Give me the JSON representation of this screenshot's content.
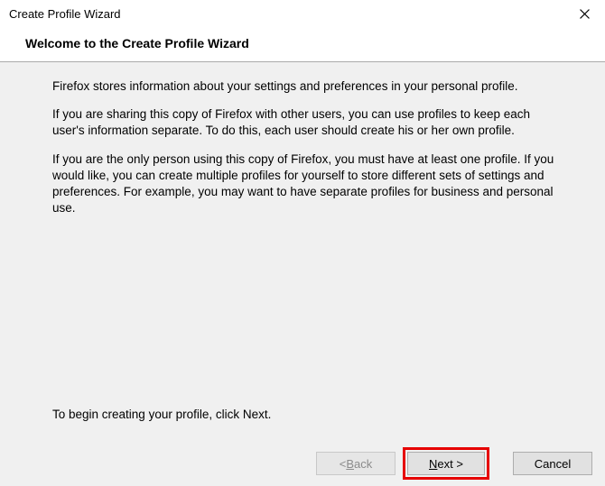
{
  "titlebar": {
    "title": "Create Profile Wizard"
  },
  "header": {
    "title": "Welcome to the Create Profile Wizard"
  },
  "body": {
    "p1": "Firefox stores information about your settings and preferences in your personal profile.",
    "p2": "If you are sharing this copy of Firefox with other users, you can use profiles to keep each user's information separate. To do this, each user should create his or her own profile.",
    "p3": "If you are the only person using this copy of Firefox, you must have at least one profile. If you would like, you can create multiple profiles for yourself to store different sets of settings and preferences. For example, you may want to have separate profiles for business and personal use.",
    "begin": "To begin creating your profile, click Next."
  },
  "buttons": {
    "back_prefix": "< ",
    "back_mn": "B",
    "back_rest": "ack",
    "next_mn": "N",
    "next_rest": "ext >",
    "cancel": "Cancel"
  }
}
